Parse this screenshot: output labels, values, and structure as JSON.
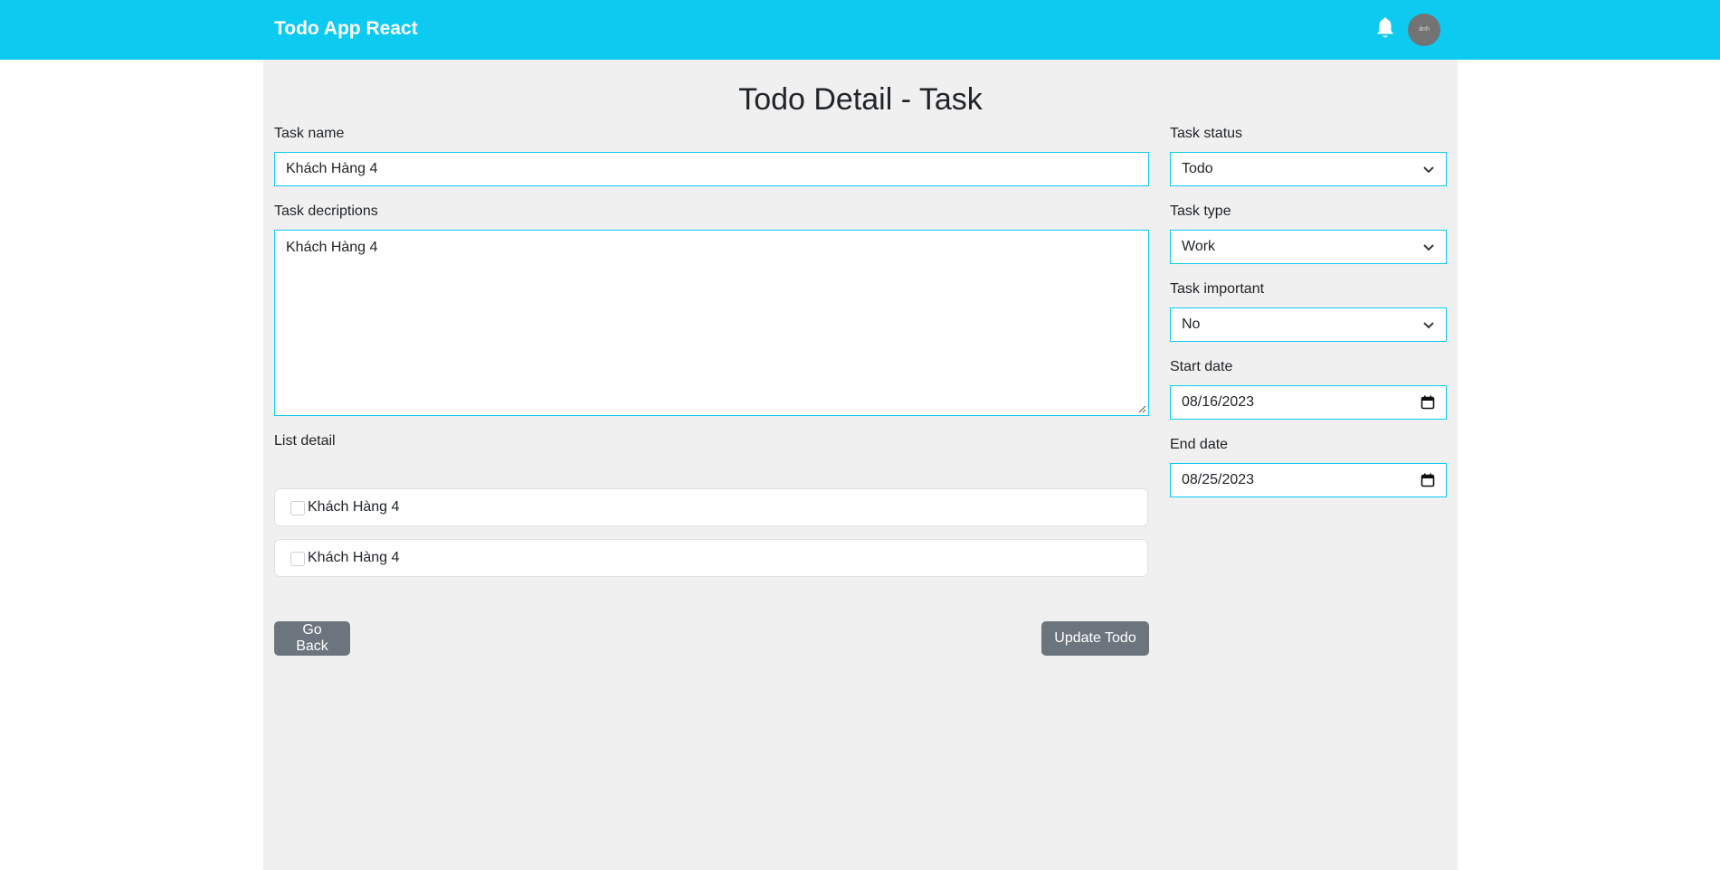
{
  "header": {
    "brand": "Todo App React",
    "avatar_text": "ảnh"
  },
  "page": {
    "title": "Todo Detail - Task"
  },
  "form": {
    "task_name_label": "Task name",
    "task_name_value": "Khách Hàng 4",
    "description_label": "Task decriptions",
    "description_value": "Khách Hàng 4",
    "list_detail_label": "List detail",
    "list_items": [
      {
        "label": "Khách Hàng 4",
        "checked": false
      },
      {
        "label": "Khách Hàng 4",
        "checked": false
      }
    ],
    "status_label": "Task status",
    "status_value": "Todo",
    "type_label": "Task type",
    "type_value": "Work",
    "important_label": "Task important",
    "important_value": "No",
    "start_date_label": "Start date",
    "start_date_value": "08/16/2023",
    "end_date_label": "End date",
    "end_date_value": "08/25/2023"
  },
  "actions": {
    "go_back_label": "Go Back",
    "update_label": "Update Todo"
  },
  "colors": {
    "navbar": "#0dcaf0",
    "field_border": "#0dcaf0",
    "button": "#6c757d",
    "container_bg": "#f0f0f0"
  }
}
